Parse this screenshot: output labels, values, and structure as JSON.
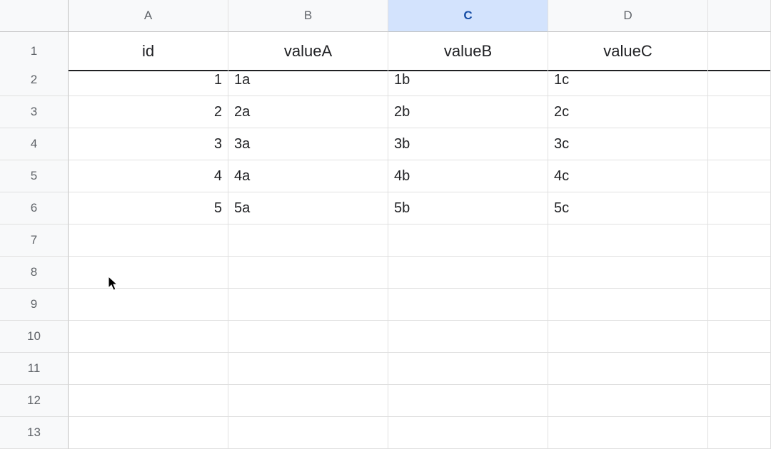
{
  "columns": [
    "A",
    "B",
    "C",
    "D"
  ],
  "selectedColumn": "C",
  "rowNumbers": [
    1,
    2,
    3,
    4,
    5,
    6,
    7,
    8,
    9,
    10,
    11,
    12,
    13
  ],
  "headerRow": {
    "A": "id",
    "B": "valueA",
    "C": "valueB",
    "D": "valueC"
  },
  "dataRows": [
    {
      "A": "1",
      "B": "1a",
      "C": "1b",
      "D": "1c"
    },
    {
      "A": "2",
      "B": "2a",
      "C": "2b",
      "D": "2c"
    },
    {
      "A": "3",
      "B": "3a",
      "C": "3b",
      "D": "3c"
    },
    {
      "A": "4",
      "B": "4a",
      "C": "4b",
      "D": "4c"
    },
    {
      "A": "5",
      "B": "5a",
      "C": "5b",
      "D": "5c"
    }
  ]
}
